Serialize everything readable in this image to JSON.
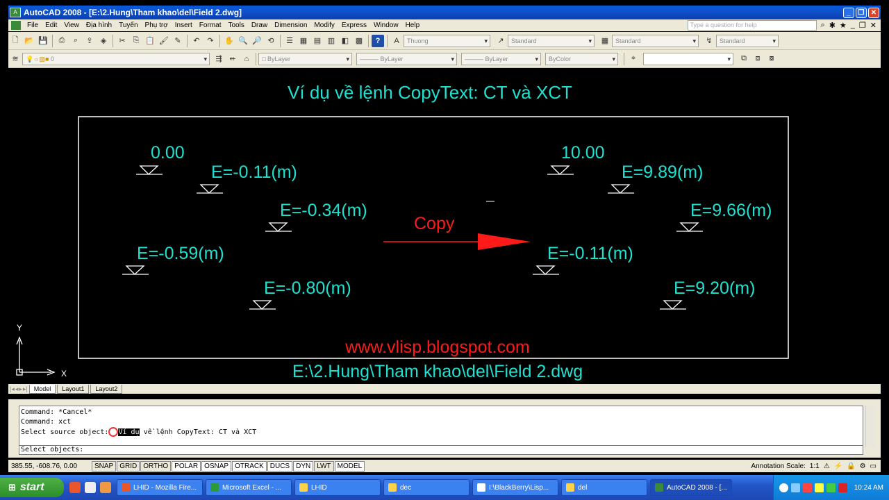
{
  "window": {
    "title": "AutoCAD 2008 - [E:\\2.Hung\\Tham khao\\del\\Field 2.dwg]",
    "app_icon": "autocad-icon",
    "controls": [
      "minimize",
      "restore",
      "close"
    ]
  },
  "menu": {
    "items": [
      "File",
      "Edit",
      "View",
      "Địa hình",
      "Tuyến",
      "Phụ trợ",
      "Insert",
      "Format",
      "Tools",
      "Draw",
      "Dimension",
      "Modify",
      "Express",
      "Window",
      "Help"
    ],
    "help_search_placeholder": "Type a question for help"
  },
  "toolbar1": {
    "text_style": "Thuong",
    "dim_style": "Standard",
    "table_style": "Standard",
    "ml_style": "Standard"
  },
  "toolbar2": {
    "layer": "0",
    "color": "ByLayer",
    "linetype": "ByLayer",
    "lineweight": "ByLayer",
    "plotstyle": "ByColor"
  },
  "drawing": {
    "colors": {
      "background": "#000000",
      "cyan": "#20e0d0",
      "red": "#ff1a1a",
      "white": "#ffffff"
    },
    "heading": "Ví dụ về lệnh CopyText: CT và XCT",
    "left_labels": [
      "0.00",
      "E=-0.11(m)",
      "E=-0.34(m)",
      "E=-0.59(m)",
      "E=-0.80(m)"
    ],
    "right_labels": [
      "10.00",
      "E=9.89(m)",
      "E=9.66(m)",
      "E=-0.11(m)",
      "E=9.20(m)"
    ],
    "arrow_label": "Copy",
    "website": "www.vlisp.blogspot.com",
    "file_path": "E:\\2.Hung\\Tham khao\\del\\Field 2.dwg",
    "ucs_x": "X",
    "ucs_y": "Y"
  },
  "tabs": [
    "Model",
    "Layout1",
    "Layout2"
  ],
  "command": {
    "line1": "Command: *Cancel*",
    "line2": "Command: xct",
    "line3_prefix": "Select source object: ",
    "line3_highlight": "Ví dụ",
    "line3_rest": " về lệnh CopyText: CT và XCT",
    "prompt": "Select objects:"
  },
  "status": {
    "coords": "385.55, -608.76, 0.00",
    "buttons": [
      "SNAP",
      "GRID",
      "ORTHO",
      "POLAR",
      "OSNAP",
      "OTRACK",
      "DUCS",
      "DYN",
      "LWT",
      "MODEL"
    ],
    "annotation_scale_label": "Annotation Scale:",
    "annotation_scale_value": "1:1"
  },
  "taskbar": {
    "start_label": "start",
    "tasks": [
      {
        "label": "LHID - Mozilla Fire...",
        "icon": "firefox-icon"
      },
      {
        "label": "Microsoft Excel - ...",
        "icon": "excel-icon"
      },
      {
        "label": "LHID",
        "icon": "folder-icon"
      },
      {
        "label": "dec",
        "icon": "folder-icon"
      },
      {
        "label": "I:\\BlackBerry\\Lisp...",
        "icon": "document-icon"
      },
      {
        "label": "del",
        "icon": "folder-icon"
      },
      {
        "label": "AutoCAD 2008 - [...",
        "icon": "autocad-icon",
        "active": true
      }
    ],
    "clock": "10:24 AM"
  }
}
